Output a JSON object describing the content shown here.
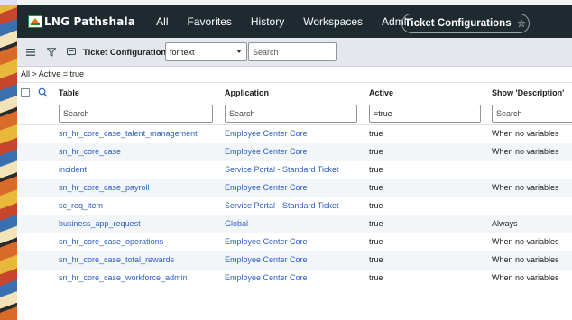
{
  "brand": {
    "logo_text": "LNG Pathshala"
  },
  "nav": {
    "items": [
      "All",
      "Favorites",
      "History",
      "Workspaces",
      "Admin"
    ],
    "context_title": "Ticket Configurations"
  },
  "toolbar": {
    "list_title": "Ticket Configurations",
    "search_field": "for text",
    "search_placeholder": "Search"
  },
  "breadcrumb": "All > Active = true",
  "table": {
    "columns": [
      "Table",
      "Application",
      "Active",
      "Show 'Description'"
    ],
    "filters": [
      {
        "value": "",
        "placeholder": "Search"
      },
      {
        "value": "",
        "placeholder": "Search"
      },
      {
        "value": "=true",
        "placeholder": ""
      },
      {
        "value": "",
        "placeholder": "Search"
      }
    ],
    "rows": [
      {
        "table": "sn_hr_core_case_talent_management",
        "application": "Employee Center Core",
        "active": "true",
        "show_description": "When no variables"
      },
      {
        "table": "sn_hr_core_case",
        "application": "Employee Center Core",
        "active": "true",
        "show_description": "When no variables"
      },
      {
        "table": "incident",
        "application": "Service Portal - Standard Ticket",
        "active": "true",
        "show_description": ""
      },
      {
        "table": "sn_hr_core_case_payroll",
        "application": "Employee Center Core",
        "active": "true",
        "show_description": "When no variables"
      },
      {
        "table": "sc_req_item",
        "application": "Service Portal - Standard Ticket",
        "active": "true",
        "show_description": ""
      },
      {
        "table": "business_app_request",
        "application": "Global",
        "active": "true",
        "show_description": "Always"
      },
      {
        "table": "sn_hr_core_case_operations",
        "application": "Employee Center Core",
        "active": "true",
        "show_description": "When no variables"
      },
      {
        "table": "sn_hr_core_case_total_rewards",
        "application": "Employee Center Core",
        "active": "true",
        "show_description": "When no variables"
      },
      {
        "table": "sn_hr_core_case_workforce_admin",
        "application": "Employee Center Core",
        "active": "true",
        "show_description": "When no variables"
      }
    ]
  },
  "icons": {
    "menu": "hamburger-icon",
    "filter": "funnel-icon",
    "list": "list-context-icon",
    "search": "magnifier-icon",
    "favorite": "star-icon"
  },
  "colors": {
    "nav_bg": "#1e2a2f",
    "link": "#2c5ec5",
    "toolbar_bg": "#e4e8ec",
    "alt_row": "#f3f6f8"
  }
}
